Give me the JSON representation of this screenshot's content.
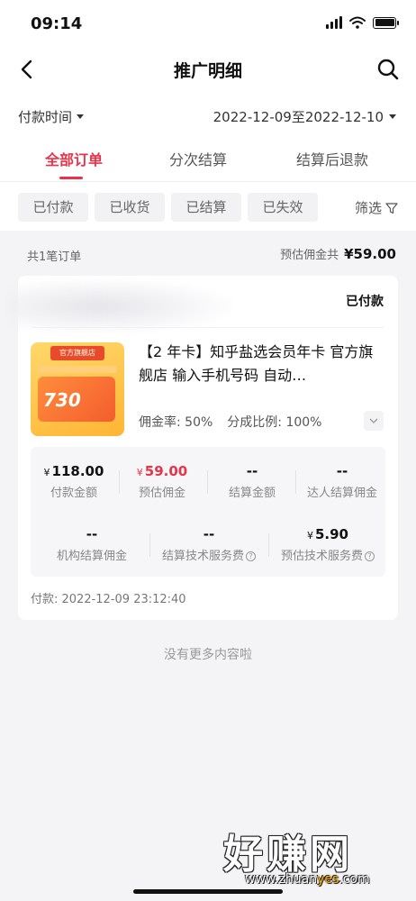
{
  "status_bar": {
    "time": "09:14"
  },
  "nav": {
    "title": "推广明细"
  },
  "filters": {
    "time_label": "付款时间",
    "date_range": "2022-12-09至2022-12-10"
  },
  "tabs": [
    {
      "label": "全部订单",
      "active": true
    },
    {
      "label": "分次结算",
      "active": false
    },
    {
      "label": "结算后退款",
      "active": false
    }
  ],
  "chips": [
    "已付款",
    "已收货",
    "已结算",
    "已失效"
  ],
  "filter_button": "筛选",
  "summary": {
    "count": "共1笔订单",
    "est_label": "预估佣金共",
    "est_amount": "¥59.00"
  },
  "order": {
    "status": "已付款",
    "product": {
      "banner": "官方旗舰店",
      "image_number": "730",
      "title": "【2 年卡】知乎盐选会员年卡 官方旗舰店 输入手机号码 自动…",
      "commission_rate": "佣金率: 50%",
      "share_ratio": "分成比例: 100%"
    },
    "stats_row1": [
      {
        "currency": "¥",
        "value": "118.00",
        "label": "付款金额",
        "highlight": false
      },
      {
        "currency": "¥",
        "value": "59.00",
        "label": "预估佣金",
        "highlight": true
      },
      {
        "currency": "",
        "value": "--",
        "label": "结算金额",
        "highlight": false
      },
      {
        "currency": "",
        "value": "--",
        "label": "达人结算佣金",
        "highlight": false
      }
    ],
    "stats_row2": [
      {
        "currency": "",
        "value": "--",
        "label": "机构结算佣金"
      },
      {
        "currency": "",
        "value": "--",
        "label": "结算技术服务费"
      },
      {
        "currency": "¥",
        "value": "5.90",
        "label": "预估技术服务费"
      }
    ],
    "pay_time": "付款: 2022-12-09 23:12:40"
  },
  "no_more": "没有更多内容啦",
  "watermark": {
    "main": "好赚网",
    "url_prefix": "www.zhuan",
    "url_mid": "yes",
    "url_suffix": ".com"
  },
  "colors": {
    "accent": "#e8334a"
  }
}
